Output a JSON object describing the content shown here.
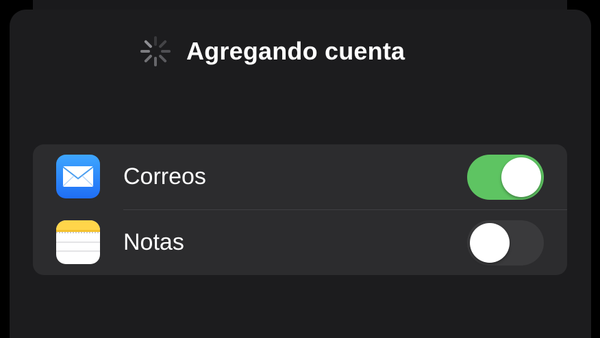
{
  "sheet": {
    "title": "Agregando cuenta",
    "loading_icon": "activity-spinner-icon"
  },
  "options": [
    {
      "label": "Correos",
      "icon": "mail-app-icon",
      "enabled": true
    },
    {
      "label": "Notas",
      "icon": "notes-app-icon",
      "enabled": false
    }
  ],
  "colors": {
    "background": "#000000",
    "sheet": "#1c1c1e",
    "group": "#2c2c2e",
    "toggle_on": "#5ec462",
    "toggle_off": "#3a3a3c",
    "text": "#ffffff"
  }
}
